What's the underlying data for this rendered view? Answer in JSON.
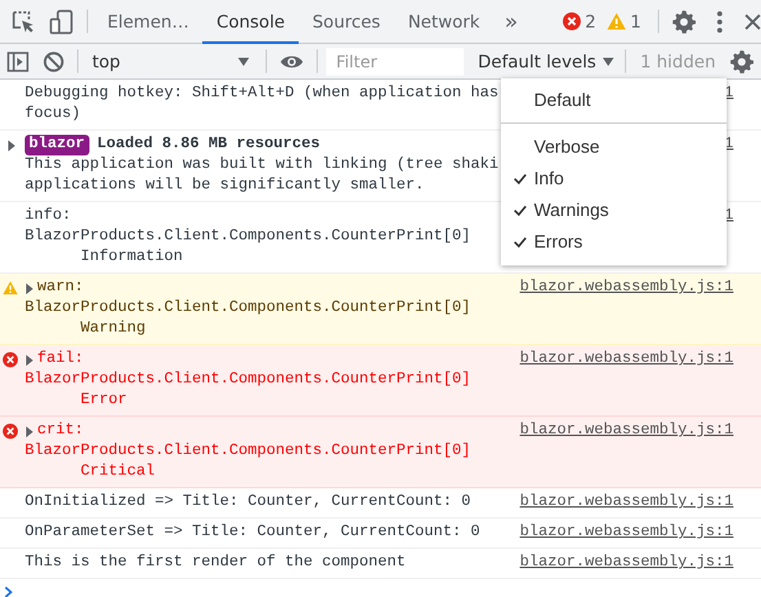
{
  "main_toolbar": {
    "tabs": [
      {
        "label": "Elemen…",
        "selected": false
      },
      {
        "label": "Console",
        "selected": true
      },
      {
        "label": "Sources",
        "selected": false
      },
      {
        "label": "Network",
        "selected": false
      }
    ],
    "more_tabs": "»",
    "error_count": "2",
    "warning_count": "1"
  },
  "console_toolbar": {
    "context": "top",
    "filter": {
      "placeholder": "Filter"
    },
    "levels_button": "Default levels",
    "hidden_count": "1 hidden"
  },
  "messages": [
    {
      "kind": "log",
      "expandable": false,
      "lines": [
        "Debugging hotkey: Shift+Alt+D (when application has",
        "focus)"
      ],
      "source": "1"
    },
    {
      "kind": "group",
      "expandable": true,
      "badge": "blazor",
      "heading": "Loaded 8.86 MB resources",
      "lines": [
        "This application was built with linking (tree shaki",
        "applications will be significantly smaller."
      ],
      "source": "1"
    },
    {
      "kind": "log",
      "expandable": false,
      "lines": [
        "info:",
        "BlazorProducts.Client.Components.CounterPrint[0]",
        "      Information"
      ],
      "source": "1"
    },
    {
      "kind": "warning",
      "expandable": true,
      "lines": [
        "warn:",
        "BlazorProducts.Client.Components.CounterPrint[0]",
        "      Warning"
      ],
      "source": "blazor.webassembly.js:1"
    },
    {
      "kind": "error",
      "expandable": true,
      "lines": [
        "fail:",
        "BlazorProducts.Client.Components.CounterPrint[0]",
        "      Error"
      ],
      "source": "blazor.webassembly.js:1"
    },
    {
      "kind": "error",
      "expandable": true,
      "lines": [
        "crit:",
        "BlazorProducts.Client.Components.CounterPrint[0]",
        "      Critical"
      ],
      "source": "blazor.webassembly.js:1"
    },
    {
      "kind": "log",
      "expandable": false,
      "lines": [
        "OnInitialized => Title: Counter, CurrentCount: 0"
      ],
      "source": "blazor.webassembly.js:1"
    },
    {
      "kind": "log",
      "expandable": false,
      "lines": [
        "OnParameterSet => Title: Counter, CurrentCount: 0"
      ],
      "source": "blazor.webassembly.js:1"
    },
    {
      "kind": "log",
      "expandable": false,
      "lines": [
        "This is the first render of the component"
      ],
      "source": "blazor.webassembly.js:1"
    }
  ],
  "levels_menu": {
    "default_option": "Default",
    "levels": [
      {
        "label": "Verbose",
        "checked": false
      },
      {
        "label": "Info",
        "checked": true
      },
      {
        "label": "Warnings",
        "checked": true
      },
      {
        "label": "Errors",
        "checked": true
      }
    ]
  }
}
